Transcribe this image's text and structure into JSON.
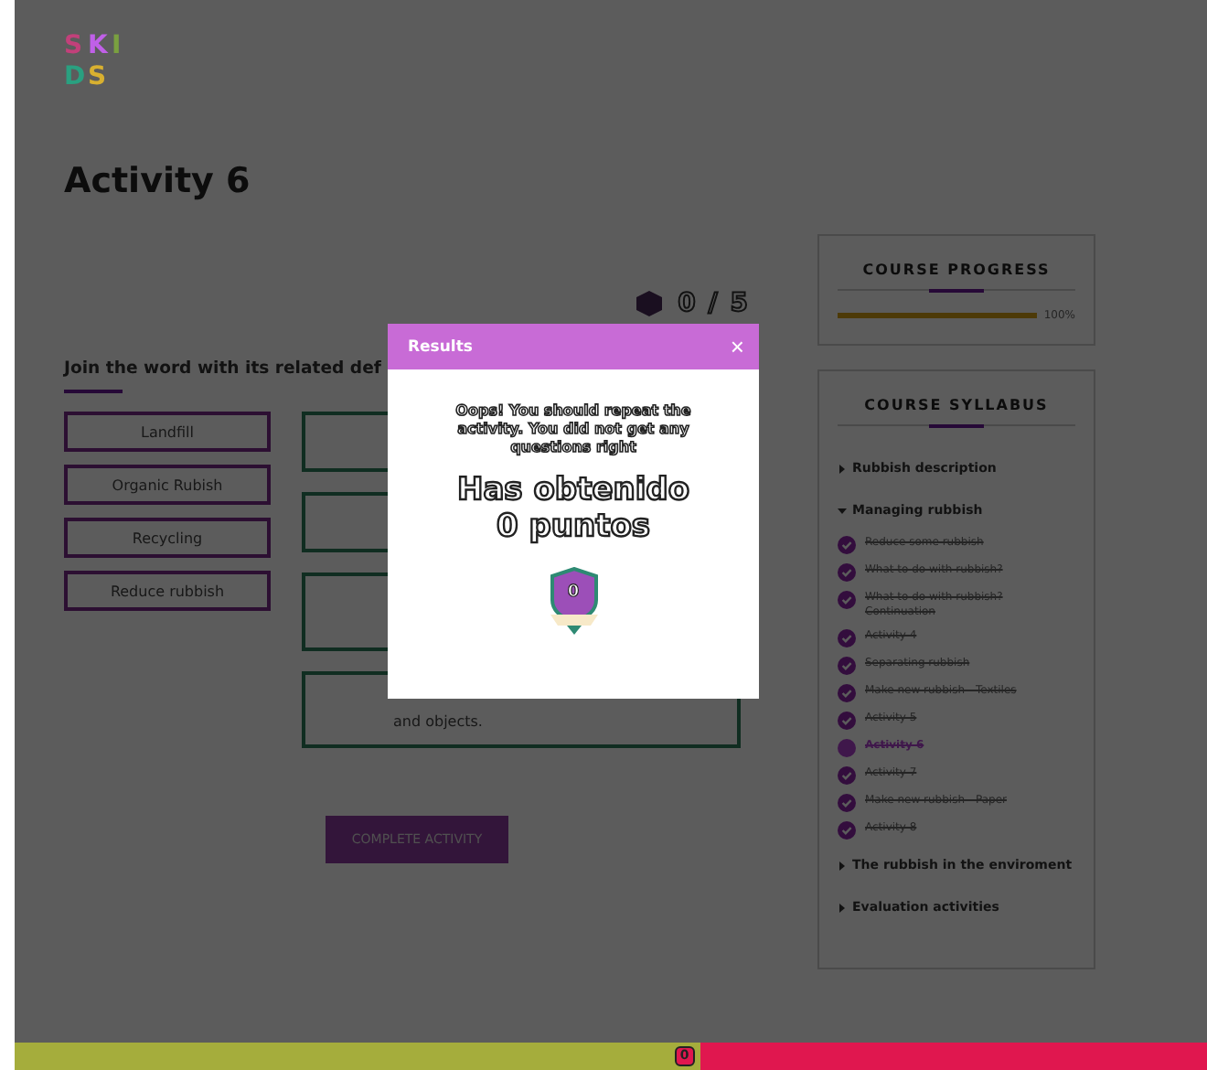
{
  "logo": {
    "letters": [
      "S",
      "K",
      "I",
      "D",
      "S"
    ]
  },
  "page": {
    "title": "Activity 6",
    "counter": "0 / 5"
  },
  "exercise": {
    "instruction": "Join the word with its related def",
    "words": [
      "Landfill",
      "Organic Rubish",
      "Recycling",
      "Reduce rubbish"
    ],
    "definitions": [
      {
        "kind": "empty"
      },
      {
        "kind": "empty"
      },
      {
        "kind": "empty"
      },
      {
        "kind": "text",
        "text": "and objects."
      }
    ],
    "button": "COMPLETE ACTIVITY"
  },
  "progress_card": {
    "title": "COURSE PROGRESS",
    "level": 1,
    "reading": "100%"
  },
  "syllabus": {
    "title": "COURSE SYLLABUS",
    "sections": [
      {
        "label": "Rubbish description",
        "expanded": false
      },
      {
        "label": "Managing rubbish",
        "expanded": true,
        "children": [
          {
            "label": "Reduce some rubbish",
            "selected": false
          },
          {
            "label": "What to do with rubbish?",
            "selected": false
          },
          {
            "label": "What to do with rubbish? Continuation",
            "selected": false
          },
          {
            "label": "Activity 4",
            "selected": false
          },
          {
            "label": "Separating rubbish",
            "selected": false
          },
          {
            "label": "Make new rubbish - Textiles",
            "selected": false
          },
          {
            "label": "Activity 5",
            "selected": false
          },
          {
            "label": "Activity 6",
            "selected": true
          },
          {
            "label": "Activity 7",
            "selected": false
          },
          {
            "label": "Make new rubbish - Paper",
            "selected": false
          },
          {
            "label": "Activity 8",
            "selected": false
          }
        ]
      },
      {
        "label": "The rubbish in the enviroment",
        "expanded": false
      },
      {
        "label": "Evaluation activities",
        "expanded": false
      }
    ]
  },
  "modal": {
    "title": "Results",
    "close": "×",
    "message": "Oops! You should repeat the activity. You did not get any questions right",
    "score": "Has obtenido 0 puntos",
    "badge": "0"
  },
  "bottom_bar": {
    "level": 0.575,
    "marker": "0"
  }
}
